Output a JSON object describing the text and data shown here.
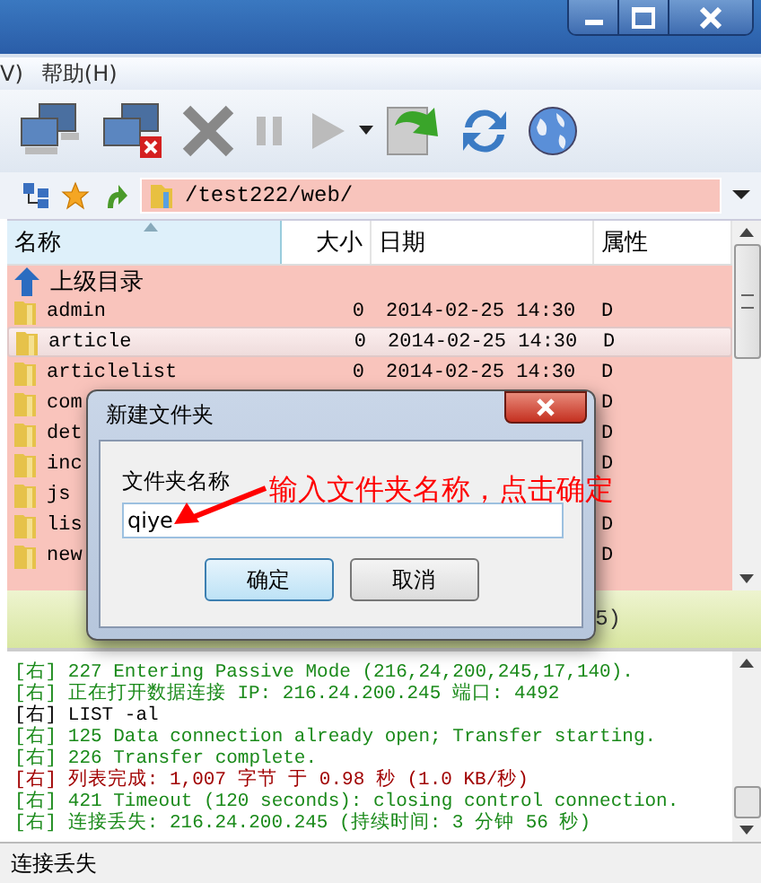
{
  "menu": [
    "V)",
    "帮助(H)"
  ],
  "address": {
    "value": "/test222/web/"
  },
  "columns": [
    "名称",
    "大小",
    "日期",
    "属性"
  ],
  "rows": [
    {
      "kind": "up",
      "name": "上级目录",
      "selected": false
    },
    {
      "kind": "folder",
      "name": "admin",
      "size": "0",
      "date": "2014-02-25 14:30",
      "attr": "D",
      "selected": false
    },
    {
      "kind": "folder",
      "name": "article",
      "size": "0",
      "date": "2014-02-25 14:30",
      "attr": "D",
      "selected": true
    },
    {
      "kind": "folder",
      "name": "articlelist",
      "size": "0",
      "date": "2014-02-25 14:30",
      "attr": "D",
      "selected": false
    },
    {
      "kind": "folder",
      "name": "com",
      "attr": "D",
      "selected": false
    },
    {
      "kind": "folder",
      "name": "det",
      "attr": "D",
      "selected": false
    },
    {
      "kind": "folder",
      "name": "inc",
      "attr": "D",
      "selected": false
    },
    {
      "kind": "folder",
      "name": "js",
      "selected": false
    },
    {
      "kind": "folder",
      "name": "lis",
      "attr": "D",
      "selected": false
    },
    {
      "kind": "folder",
      "name": "new",
      "attr": "D",
      "selected": false
    }
  ],
  "strip_text": "5)",
  "log": [
    {
      "kind": "reply",
      "tag": "[右]",
      "text": "227 Entering Passive Mode (216,24,200,245,17,140)."
    },
    {
      "kind": "reply",
      "tag": "[右]",
      "text": "正在打开数据连接 IP: 216.24.200.245 端口: 4492"
    },
    {
      "kind": "command",
      "tag": "[右]",
      "text": "LIST -al"
    },
    {
      "kind": "reply",
      "tag": "[右]",
      "text": "125 Data connection already open; Transfer starting."
    },
    {
      "kind": "reply",
      "tag": "[右]",
      "text": "226 Transfer complete."
    },
    {
      "kind": "status",
      "tag": "[右]",
      "text": "列表完成: 1,007 字节 于 0.98 秒 (1.0 KB/秒)"
    },
    {
      "kind": "reply",
      "tag": "[右]",
      "text": "421 Timeout (120 seconds): closing control connection."
    },
    {
      "kind": "reply",
      "tag": "[右]",
      "text": "连接丢失: 216.24.200.245 (持续时间: 3 分钟 56 秒)"
    }
  ],
  "status_bar": "连接丢失",
  "dialog": {
    "title": "新建文件夹",
    "label": "文件夹名称",
    "value": "qiye",
    "buttons": [
      "确定",
      "取消"
    ]
  },
  "annotation": "输入文件夹名称，点击确定"
}
